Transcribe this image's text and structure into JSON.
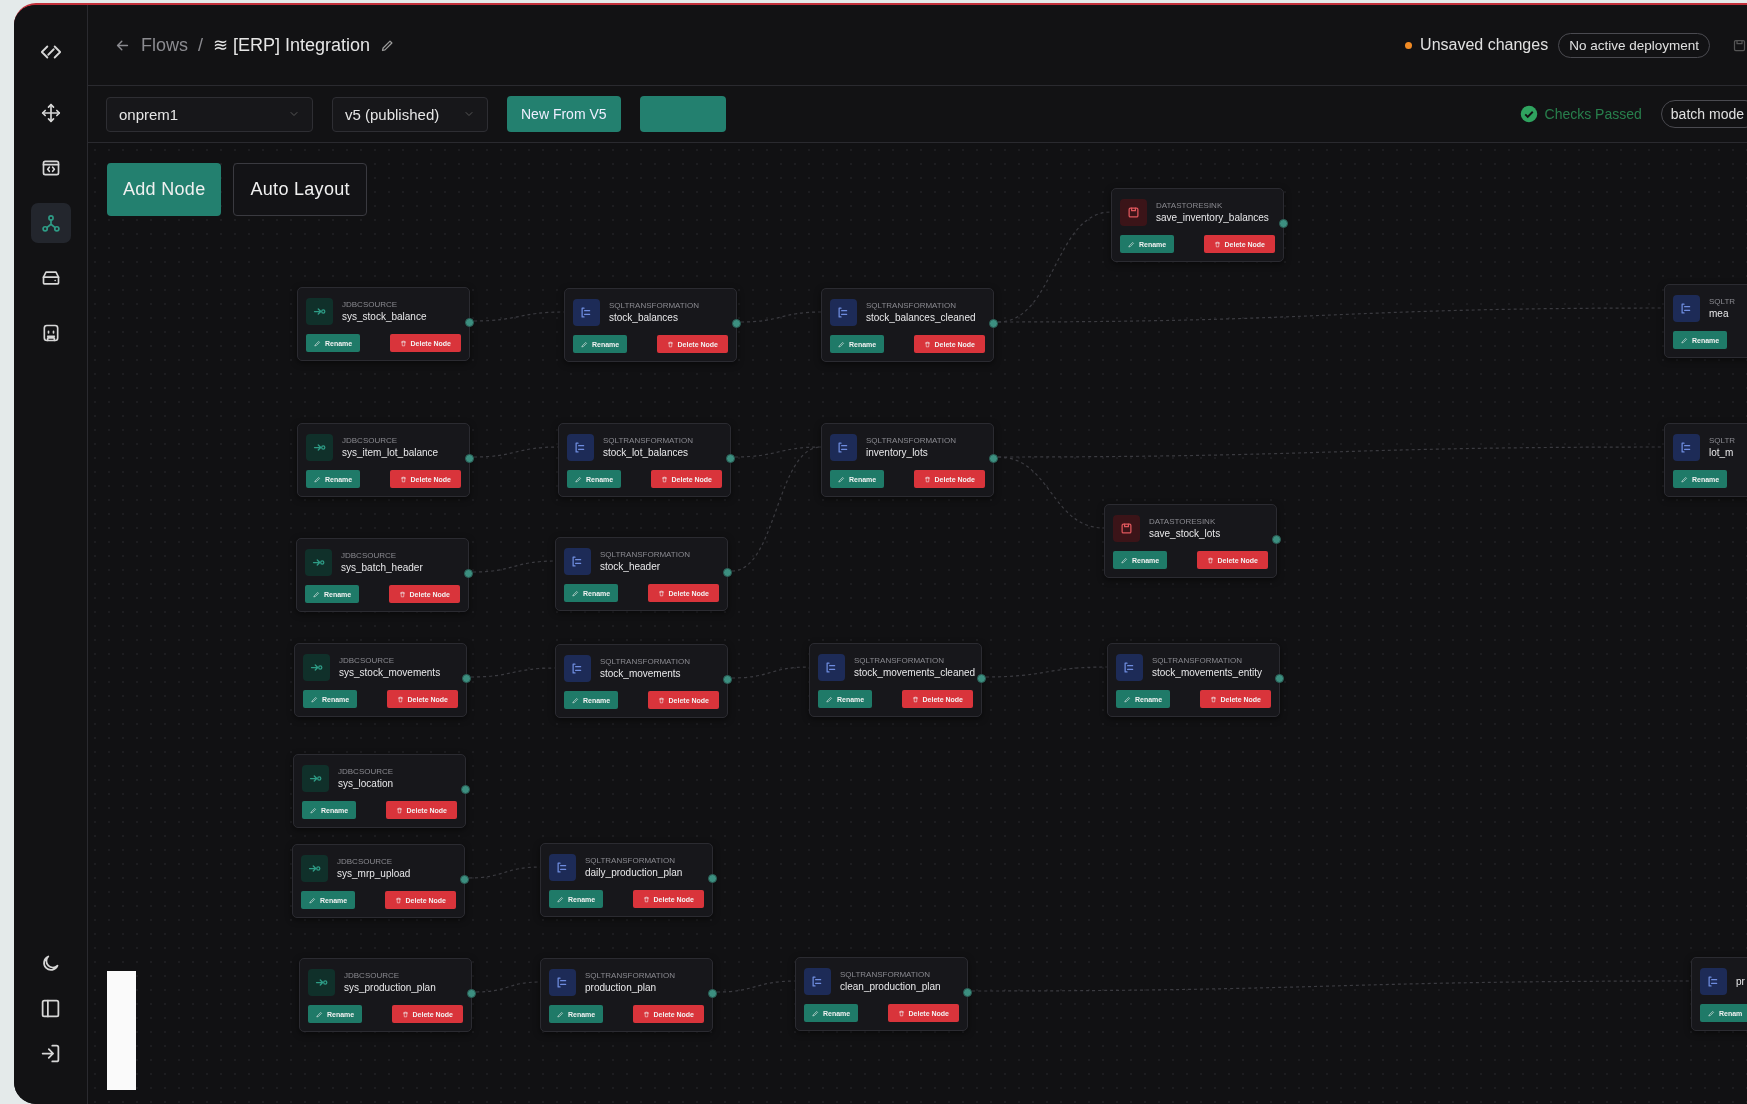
{
  "breadcrumb": {
    "parent": "Flows",
    "separator": "/",
    "title": "≋ [ERP] Integration"
  },
  "status": {
    "unsaved": true,
    "unsaved_label": "Unsaved changes",
    "deployment": "No active deployment"
  },
  "toolbar": {
    "environment": "onprem1",
    "version": "v5 (published)",
    "new_button": "New From V5",
    "checks": "Checks Passed",
    "mode": "batch mode"
  },
  "sidebar": {
    "items": [
      {
        "selected": false
      },
      {
        "selected": false
      },
      {
        "selected": true
      },
      {
        "selected": false
      },
      {
        "selected": false
      }
    ]
  },
  "canvas": {
    "actions": [
      {
        "kind": "primary",
        "label": "Add Node"
      },
      {
        "kind": "secondary",
        "label": "Auto Layout"
      }
    ],
    "nodes": [
      {
        "kind": "sink",
        "type": "DATASTORESINK",
        "title": "save_inventory_balances",
        "rename": "Rename",
        "delete": "Delete Node"
      },
      {
        "kind": "source",
        "type": "JDBCSOURCE",
        "title": "sys_stock_balance",
        "rename": "Rename",
        "delete": "Delete Node"
      },
      {
        "kind": "transform",
        "type": "SQLTRANSFORMATION",
        "title": "stock_balances",
        "rename": "Rename",
        "delete": "Delete Node"
      },
      {
        "kind": "transform",
        "type": "SQLTRANSFORMATION",
        "title": "stock_balances_cleaned",
        "rename": "Rename",
        "delete": "Delete Node"
      },
      {
        "kind": "transform",
        "type": "SQLTR",
        "title": "mea",
        "rename": "Rename"
      },
      {
        "kind": "source",
        "type": "JDBCSOURCE",
        "title": "sys_item_lot_balance",
        "rename": "Rename",
        "delete": "Delete Node"
      },
      {
        "kind": "transform",
        "type": "SQLTRANSFORMATION",
        "title": "stock_lot_balances",
        "rename": "Rename",
        "delete": "Delete Node"
      },
      {
        "kind": "transform",
        "type": "SQLTRANSFORMATION",
        "title": "inventory_lots",
        "rename": "Rename",
        "delete": "Delete Node"
      },
      {
        "kind": "transform",
        "type": "SQLTR",
        "title": "lot_m",
        "rename": "Rename"
      },
      {
        "kind": "sink",
        "type": "DATASTORESINK",
        "title": "save_stock_lots",
        "rename": "Rename",
        "delete": "Delete Node"
      },
      {
        "kind": "source",
        "type": "JDBCSOURCE",
        "title": "sys_batch_header",
        "rename": "Rename",
        "delete": "Delete Node"
      },
      {
        "kind": "transform",
        "type": "SQLTRANSFORMATION",
        "title": "stock_header",
        "rename": "Rename",
        "delete": "Delete Node"
      },
      {
        "kind": "source",
        "type": "JDBCSOURCE",
        "title": "sys_stock_movements",
        "rename": "Rename",
        "delete": "Delete Node"
      },
      {
        "kind": "transform",
        "type": "SQLTRANSFORMATION",
        "title": "stock_movements",
        "rename": "Rename",
        "delete": "Delete Node"
      },
      {
        "kind": "transform",
        "type": "SQLTRANSFORMATION",
        "title": "stock_movements_cleaned",
        "rename": "Rename",
        "delete": "Delete Node"
      },
      {
        "kind": "transform",
        "type": "SQLTRANSFORMATION",
        "title": "stock_movements_entity",
        "rename": "Rename",
        "delete": "Delete Node"
      },
      {
        "kind": "source",
        "type": "JDBCSOURCE",
        "title": "sys_location",
        "rename": "Rename",
        "delete": "Delete Node"
      },
      {
        "kind": "source",
        "type": "JDBCSOURCE",
        "title": "sys_mrp_upload",
        "rename": "Rename",
        "delete": "Delete Node"
      },
      {
        "kind": "transform",
        "type": "SQLTRANSFORMATION",
        "title": "daily_production_plan",
        "rename": "Rename",
        "delete": "Delete Node"
      },
      {
        "kind": "source",
        "type": "JDBCSOURCE",
        "title": "sys_production_plan",
        "rename": "Rename",
        "delete": "Delete Node"
      },
      {
        "kind": "transform",
        "type": "SQLTRANSFORMATION",
        "title": "production_plan",
        "rename": "Rename",
        "delete": "Delete Node"
      },
      {
        "kind": "transform",
        "type": "SQLTRANSFORMATION",
        "title": "clean_production_plan",
        "rename": "Rename",
        "delete": "Delete Node"
      },
      {
        "kind": "transform",
        "title": "pr",
        "rename": "Renam"
      }
    ]
  }
}
